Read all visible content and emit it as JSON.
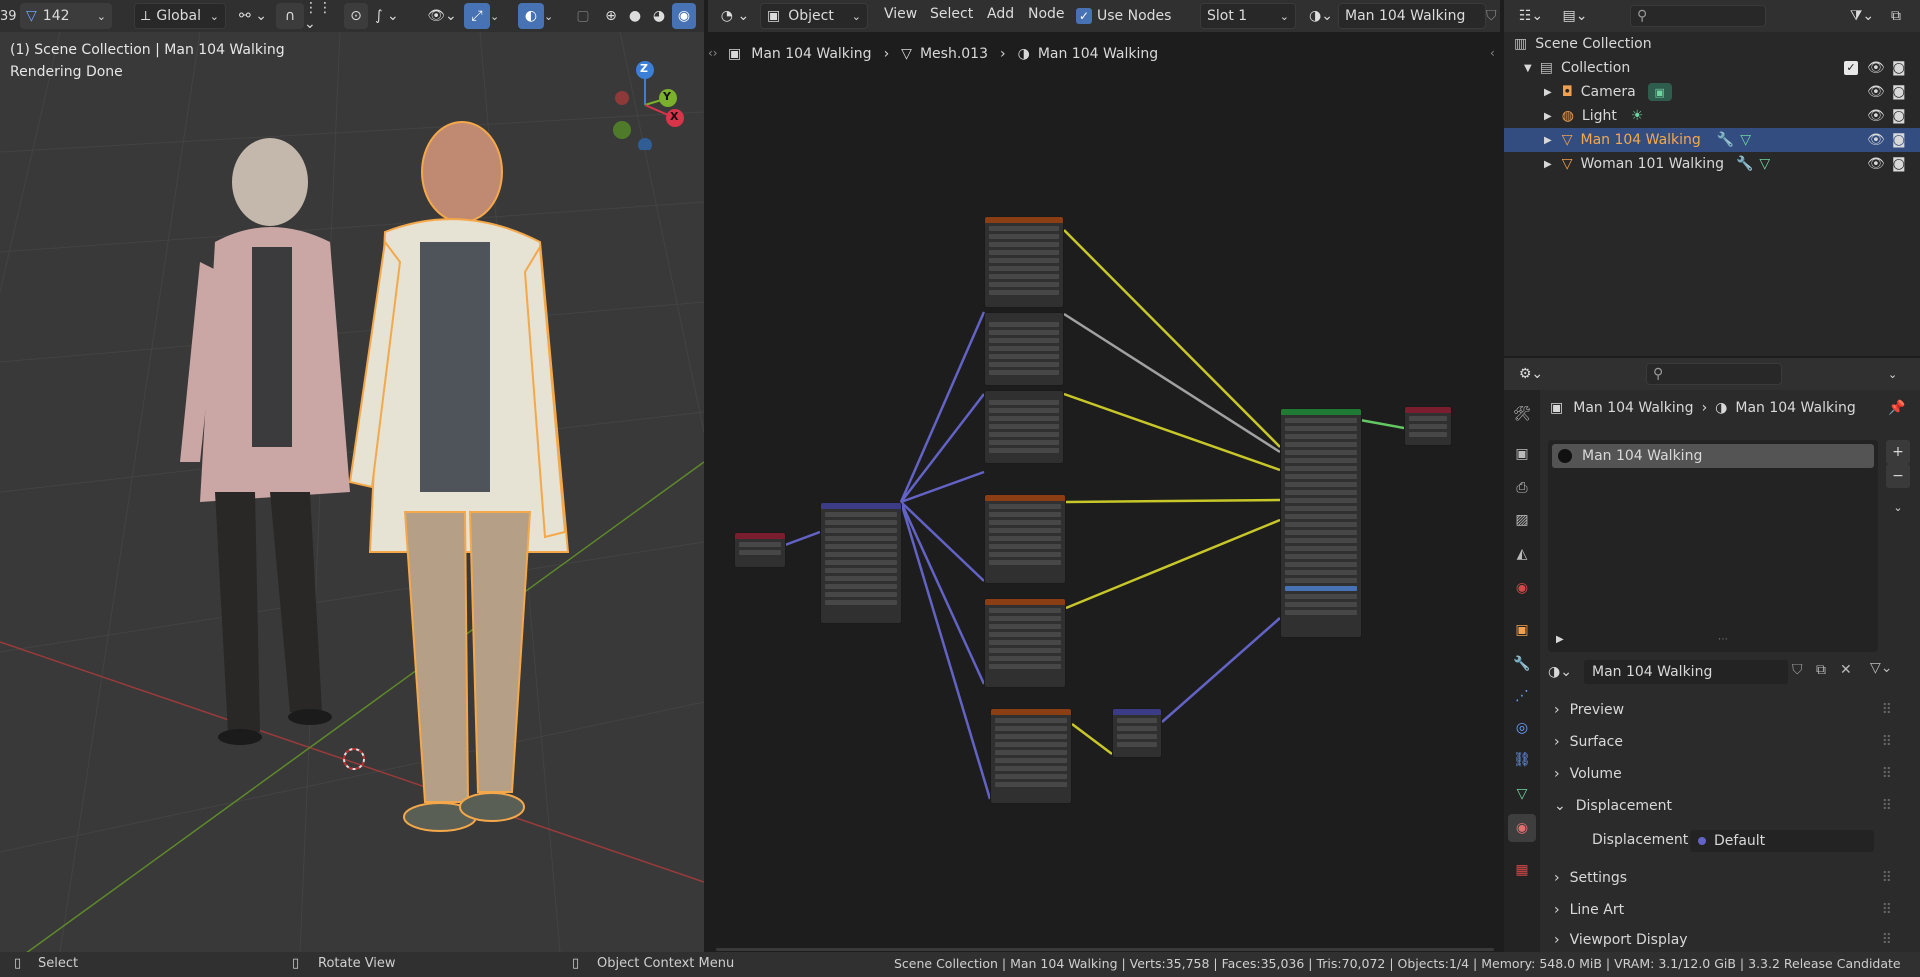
{
  "viewport_header": {
    "stat_left": "39",
    "stat_count": "142",
    "orientation": "Global"
  },
  "viewport": {
    "title": "(1) Scene Collection | Man 104 Walking",
    "status": "Rendering Done",
    "gizmo": {
      "z": "Z",
      "y": "Y",
      "x": "X"
    }
  },
  "node_header": {
    "mode": "Object",
    "menus": [
      "View",
      "Select",
      "Add",
      "Node"
    ],
    "use_nodes_label": "Use Nodes",
    "use_nodes_checked": true,
    "slot": "Slot 1",
    "material": "Man 104 Walking"
  },
  "breadcrumb": {
    "object": "Man 104 Walking",
    "mesh": "Mesh.013",
    "material": "Man 104 Walking"
  },
  "outliner": {
    "root": "Scene Collection",
    "collection": "Collection",
    "items": [
      {
        "label": "Camera",
        "selected": false
      },
      {
        "label": "Light",
        "selected": false
      },
      {
        "label": "Man 104 Walking",
        "selected": true
      },
      {
        "label": "Woman 101 Walking",
        "selected": false
      }
    ]
  },
  "properties": {
    "breadcrumb_object": "Man 104 Walking",
    "breadcrumb_material": "Man 104 Walking",
    "slot_item": "Man 104 Walking",
    "material_name": "Man 104 Walking",
    "panels": [
      "Preview",
      "Surface",
      "Volume",
      "Displacement",
      "Settings",
      "Line Art",
      "Viewport Display"
    ],
    "displacement_label": "Displacement",
    "displacement_value": "Default"
  },
  "statusbar": {
    "select": "Select",
    "rotate": "Rotate View",
    "context": "Object Context Menu",
    "info": "Scene Collection | Man 104 Walking | Verts:35,758 | Faces:35,036 | Tris:70,072 | Objects:1/4 | Memory: 548.0 MiB | VRAM: 3.1/12.0 GiB | 3.3.2 Release Candidate"
  },
  "colors": {
    "accent": "#4772b3",
    "selected_orange": "#f5a84a",
    "node_texture_header": "#8b3e13",
    "node_vector_header": "#3b3b86",
    "node_shader_header": "#1f7a33",
    "node_output_header": "#7a1d2e",
    "link_yellow": "#c7c729",
    "link_blue": "#6363c7",
    "link_gray": "#a1a1a1",
    "link_green": "#63c763"
  }
}
